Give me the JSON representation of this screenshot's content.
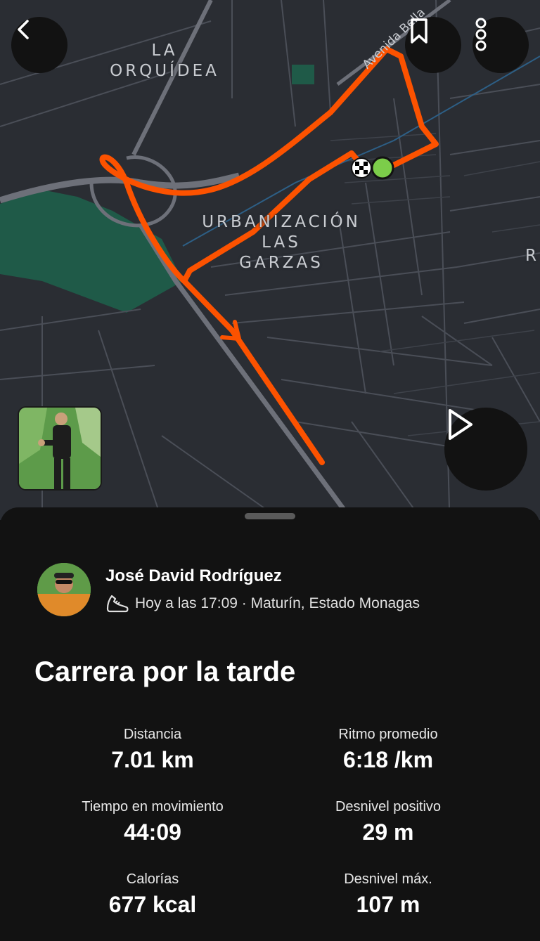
{
  "map": {
    "labels": {
      "neighborhood_1": [
        "LA",
        "ORQUÍDEA"
      ],
      "neighborhood_2": [
        "URBANIZACIÓN",
        "LAS",
        "GARZAS"
      ],
      "edge_letter": "R",
      "street": "Avenida Bella"
    },
    "route_color": "#FC5200",
    "park_color": "#1f5a48",
    "start_marker_color": "#7ccd4a"
  },
  "controls": {
    "back_icon": "chevron-left-icon",
    "bookmark_icon": "bookmark-icon",
    "more_icon": "more-vertical-icon",
    "play_icon": "play-icon"
  },
  "activity": {
    "athlete_name": "José David Rodríguez",
    "activity_type_icon": "running-shoe-icon",
    "meta": "Hoy a las 17:09 · Maturín, Estado Monagas",
    "title": "Carrera por la tarde"
  },
  "stats": [
    {
      "label": "Distancia",
      "value": "7.01 km"
    },
    {
      "label": "Ritmo promedio",
      "value": "6:18 /km"
    },
    {
      "label": "Tiempo en movimiento",
      "value": "44:09"
    },
    {
      "label": "Desnivel positivo",
      "value": "29 m"
    },
    {
      "label": "Calorías",
      "value": "677 kcal"
    },
    {
      "label": "Desnivel máx.",
      "value": "107 m"
    }
  ]
}
